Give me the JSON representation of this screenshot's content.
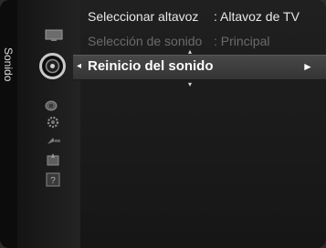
{
  "side_label": "Sonido",
  "menu": {
    "items": [
      {
        "label": "Seleccionar altavoz",
        "value": ": Altavoz de TV",
        "enabled": true
      },
      {
        "label": "Selección de sonido",
        "value": ": Principal",
        "enabled": false
      }
    ],
    "selected": {
      "label": "Reinicio del sonido",
      "arrow_left": "◂",
      "arrow_right": "►"
    },
    "scroll_up": "▴",
    "scroll_down": "▾"
  },
  "icons": [
    "picture-icon",
    "sound-icon",
    "channel-icon",
    "setup-icon",
    "input-icon",
    "application-icon",
    "support-icon"
  ],
  "colors": {
    "text": "#e8e8e8",
    "disabled_text": "#6b6b6b",
    "selection": "#404040"
  }
}
